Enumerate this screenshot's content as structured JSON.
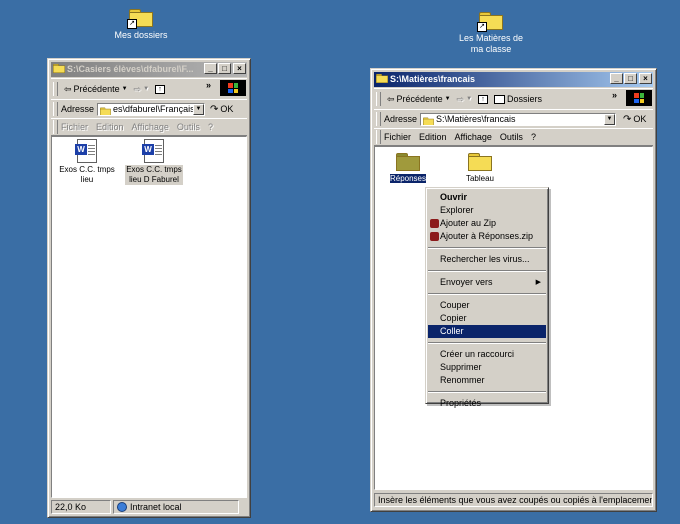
{
  "desktop": {
    "icons": [
      {
        "label": "Mes dossiers"
      },
      {
        "label_line1": "Les Matières de",
        "label_line2": "ma classe"
      }
    ]
  },
  "left_window": {
    "title": "S:\\Casiers élèves\\dfaburel\\F...",
    "toolbar": {
      "back": "Précédente",
      "more": "»"
    },
    "address": {
      "label": "Adresse",
      "value": "es\\dfaburel\\Français",
      "go": "OK"
    },
    "menu": [
      "Fichier",
      "Edition",
      "Affichage",
      "Outils",
      "?"
    ],
    "files": [
      {
        "line1": "Exos C.C. tmps",
        "line2": "lieu"
      },
      {
        "line1": "Exos C.C. tmps",
        "line2": "lieu D Faburel"
      }
    ],
    "status": {
      "size": "22,0 Ko",
      "zone": "Intranet local"
    }
  },
  "right_window": {
    "title": "S:\\Matières\\francais",
    "toolbar": {
      "back": "Précédente",
      "folders": "Dossiers",
      "more": "»"
    },
    "address": {
      "label": "Adresse",
      "value": "S:\\Matières\\francais",
      "go": "OK"
    },
    "menu": [
      "Fichier",
      "Edition",
      "Affichage",
      "Outils",
      "?"
    ],
    "folders": [
      {
        "label": "Réponses"
      },
      {
        "label": "Tableau"
      }
    ],
    "status": "Insère les éléments que vous avez coupés ou copiés à l'emplacement :"
  },
  "context_menu": {
    "items": [
      "Ouvrir",
      "Explorer",
      "Ajouter au Zip",
      "Ajouter à Réponses.zip",
      "Rechercher les virus...",
      "Envoyer vers",
      "Couper",
      "Copier",
      "Coller",
      "Créer un raccourci",
      "Supprimer",
      "Renommer",
      "Propriétés"
    ],
    "highlighted": "Coller"
  },
  "colors": {
    "desktop": "#3a6ea5",
    "active_title": "#0a246a",
    "inactive_title": "#808080",
    "face": "#d4d0c8"
  }
}
